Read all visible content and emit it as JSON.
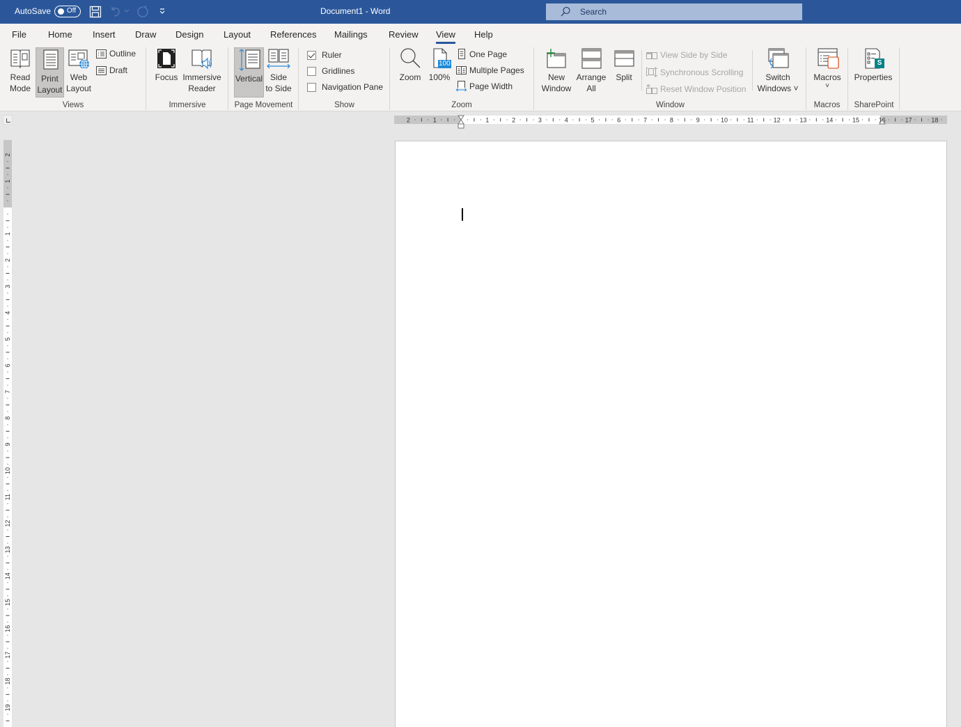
{
  "titlebar": {
    "autosave_label": "AutoSave",
    "autosave_state": "Off",
    "document_title": "Document1  -  Word",
    "search_placeholder": "Search",
    "quick_access": [
      "save-icon",
      "undo-icon",
      "redo-icon",
      "customize-icon"
    ]
  },
  "tabs": [
    {
      "label": "File"
    },
    {
      "label": "Home"
    },
    {
      "label": "Insert"
    },
    {
      "label": "Draw"
    },
    {
      "label": "Design"
    },
    {
      "label": "Layout"
    },
    {
      "label": "References"
    },
    {
      "label": "Mailings"
    },
    {
      "label": "Review"
    },
    {
      "label": "View",
      "active": true
    },
    {
      "label": "Help"
    }
  ],
  "ribbon": {
    "views": {
      "label": "Views",
      "read_mode": [
        "Read",
        "Mode"
      ],
      "print_layout": [
        "Print",
        "Layout"
      ],
      "web_layout": [
        "Web",
        "Layout"
      ],
      "outline": "Outline",
      "draft": "Draft",
      "selected": "Print Layout"
    },
    "immersive": {
      "label": "Immersive",
      "focus": "Focus",
      "immersive_reader": [
        "Immersive",
        "Reader"
      ]
    },
    "page_movement": {
      "label": "Page Movement",
      "vertical": "Vertical",
      "side_to_side": [
        "Side",
        "to Side"
      ],
      "selected": "Vertical"
    },
    "show": {
      "label": "Show",
      "ruler": {
        "label": "Ruler",
        "checked": true
      },
      "gridlines": {
        "label": "Gridlines",
        "checked": false
      },
      "navigation_pane": {
        "label": "Navigation Pane",
        "checked": false
      }
    },
    "zoom": {
      "label": "Zoom",
      "zoom": "Zoom",
      "hundred": "100%",
      "hundred_badge": "100",
      "one_page": "One Page",
      "multiple_pages": "Multiple Pages",
      "page_width": "Page Width"
    },
    "window": {
      "label": "Window",
      "new_window": [
        "New",
        "Window"
      ],
      "arrange_all": [
        "Arrange",
        "All"
      ],
      "split": "Split",
      "view_side_by_side": "View Side by Side",
      "synchronous_scrolling": "Synchronous Scrolling",
      "reset_window_position": "Reset Window Position",
      "switch_windows": [
        "Switch",
        "Windows ˅"
      ]
    },
    "macros": {
      "label": "Macros",
      "macros": "Macros",
      "dropdown": "˅"
    },
    "sharepoint": {
      "label": "SharePoint",
      "properties": "Properties",
      "badge": "S"
    }
  },
  "colors": {
    "titlebar": "#2b579a",
    "ribbon": "#f3f2f1",
    "accent": "#2b579a",
    "sharepoint": "#038387"
  },
  "hruler_labels": [
    "2",
    "1",
    "",
    "1",
    "2",
    "3",
    "4",
    "5",
    "6",
    "7",
    "8",
    "9",
    "10",
    "11",
    "12",
    "13",
    "14",
    "15",
    "16",
    "17",
    "18"
  ],
  "vruler_labels": [
    "2",
    "1",
    "",
    "1",
    "2",
    "3",
    "4",
    "5",
    "6",
    "7",
    "8",
    "9",
    "10",
    "11",
    "12",
    "13",
    "14",
    "15",
    "16",
    "17",
    "18",
    "19"
  ]
}
